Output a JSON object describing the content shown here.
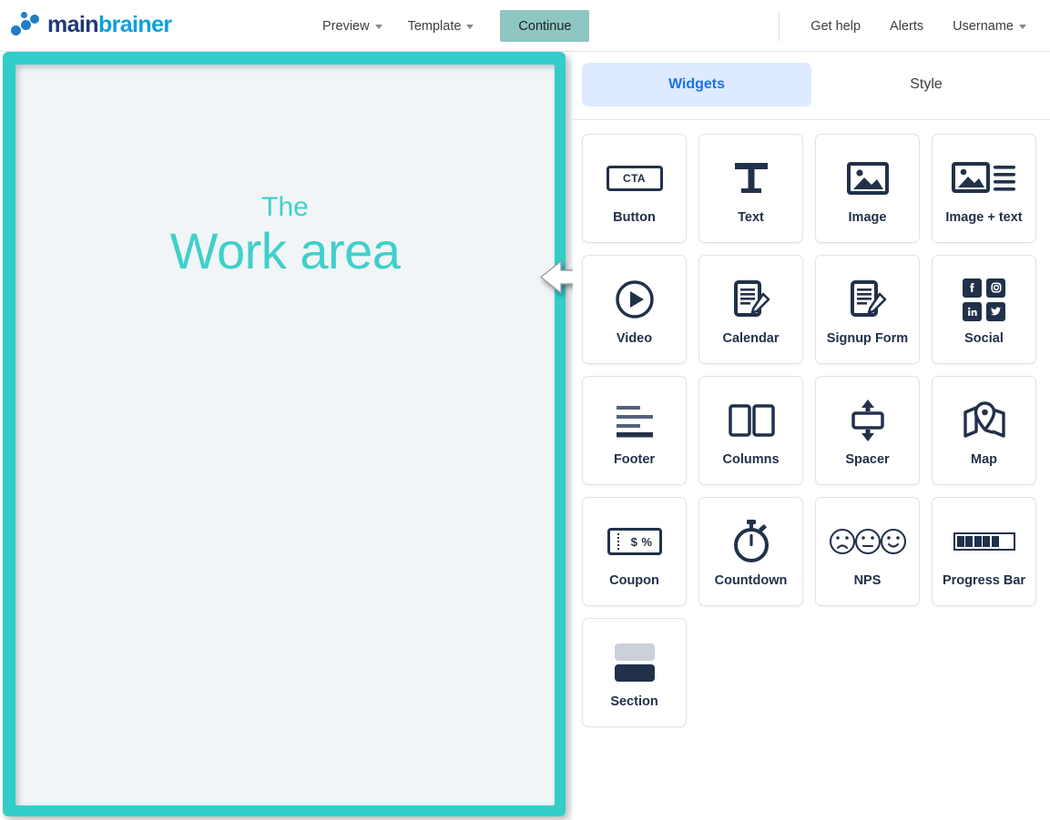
{
  "brand": {
    "name_part1": "main",
    "name_part2": "brainer",
    "logo_icon": "four-dots-diagonal",
    "color_dark": "#1d3a72",
    "color_light": "#0f9fdb"
  },
  "header": {
    "nav": [
      {
        "label": "Preview",
        "has_caret": true
      },
      {
        "label": "Template",
        "has_caret": true
      }
    ],
    "continue_label": "Continue",
    "continue_color": "#8ec6c1",
    "right_links": [
      {
        "label": "Get help",
        "has_caret": false
      },
      {
        "label": "Alerts",
        "has_caret": false
      },
      {
        "label": "Username",
        "has_caret": true
      }
    ]
  },
  "workarea": {
    "line1": "The",
    "line2": "Work area",
    "border_color": "#32cdc8",
    "canvas_color": "#f1f5f7",
    "text_color": "#3fd0cb",
    "pointer_icon": "left-arrow-pointer"
  },
  "panel": {
    "tabs": [
      {
        "label": "Widgets",
        "active": true
      },
      {
        "label": "Style",
        "active": false
      }
    ],
    "active_tab_bg": "#deeaff",
    "active_tab_color": "#1a73e8",
    "widgets": [
      {
        "label": "Button",
        "icon": "cta-button-icon",
        "icon_text": "CTA"
      },
      {
        "label": "Text",
        "icon": "text-t-icon"
      },
      {
        "label": "Image",
        "icon": "image-icon"
      },
      {
        "label": "Image + text",
        "icon": "image-plus-text-icon"
      },
      {
        "label": "Video",
        "icon": "play-circle-icon"
      },
      {
        "label": "Calendar",
        "icon": "document-pencil-icon"
      },
      {
        "label": "Signup Form",
        "icon": "document-pencil-icon"
      },
      {
        "label": "Social",
        "icon": "social-networks-icon",
        "networks": [
          "facebook",
          "instagram",
          "linkedin",
          "twitter"
        ]
      },
      {
        "label": "Footer",
        "icon": "footer-lines-icon"
      },
      {
        "label": "Columns",
        "icon": "two-columns-icon"
      },
      {
        "label": "Spacer",
        "icon": "vertical-resize-icon"
      },
      {
        "label": "Map",
        "icon": "map-pin-icon"
      },
      {
        "label": "Coupon",
        "icon": "coupon-ticket-icon",
        "icon_text": "$ %"
      },
      {
        "label": "Countdown",
        "icon": "stopwatch-icon"
      },
      {
        "label": "NPS",
        "icon": "three-faces-icon"
      },
      {
        "label": "Progress Bar",
        "icon": "progress-bar-icon",
        "filled_blocks": 5
      },
      {
        "label": "Section",
        "icon": "section-blocks-icon"
      }
    ]
  }
}
